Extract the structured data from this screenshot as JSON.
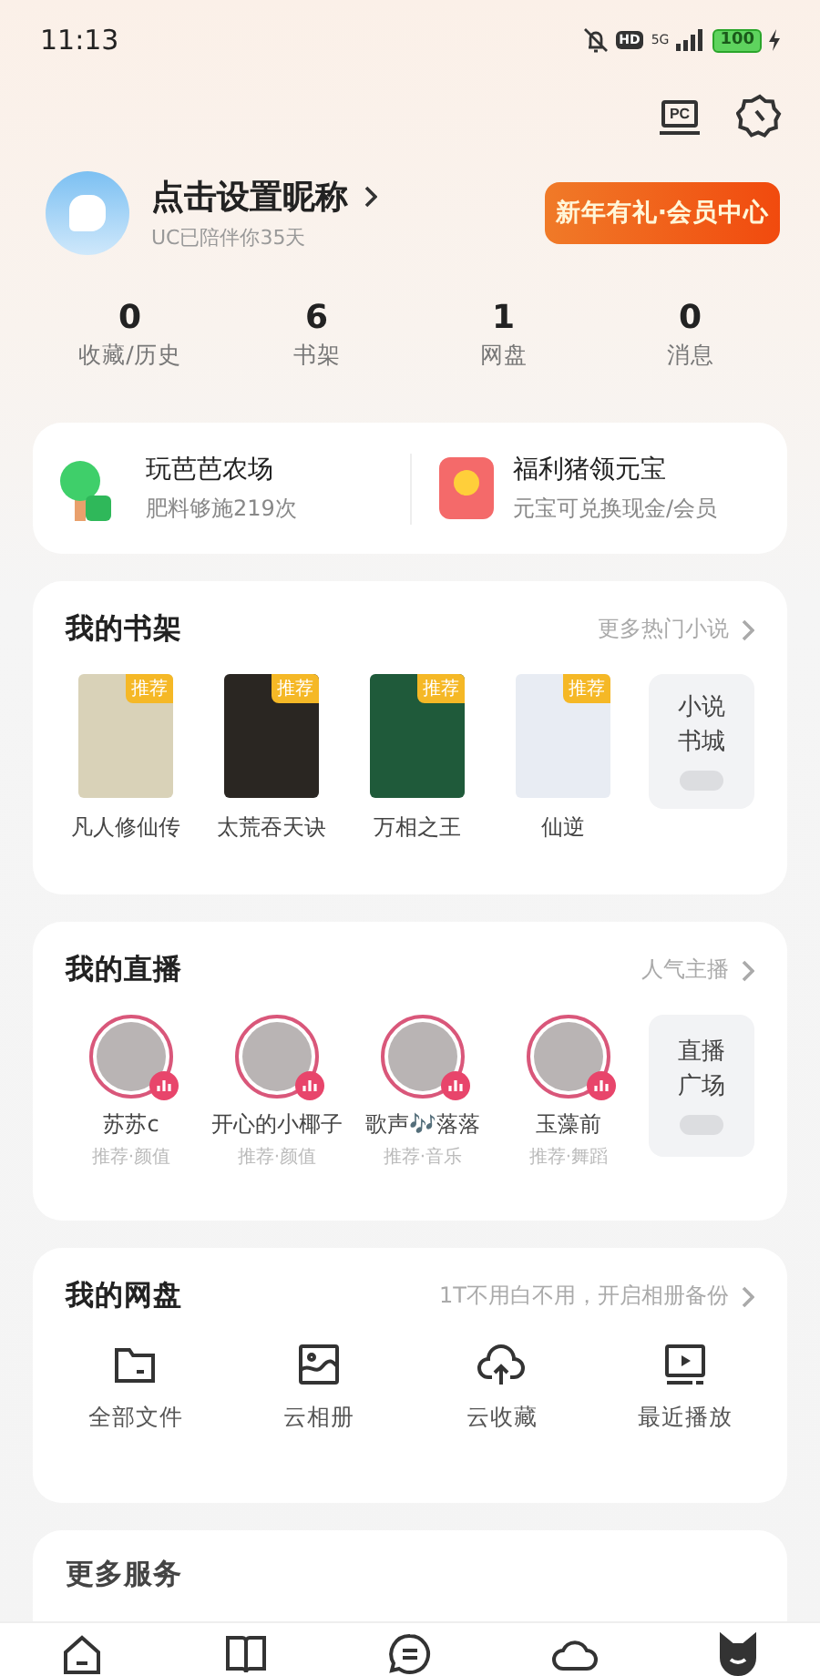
{
  "status_bar": {
    "time": "11:13",
    "hd": "HD",
    "network": "5G",
    "battery": "100"
  },
  "top_actions": {
    "pc_label": "PC"
  },
  "profile": {
    "name": "点击设置昵称",
    "subtitle": "UC已陪伴你35天",
    "vip_button": "新年有礼·会员中心"
  },
  "stats": [
    {
      "value": "0",
      "label": "收藏/历史"
    },
    {
      "value": "6",
      "label": "书架"
    },
    {
      "value": "1",
      "label": "网盘"
    },
    {
      "value": "0",
      "label": "消息"
    }
  ],
  "promos": [
    {
      "kind": "tree",
      "title": "玩芭芭农场",
      "subtitle": "肥料够施219次"
    },
    {
      "kind": "redpacket",
      "title": "福利猪领元宝",
      "subtitle": "元宝可兑换现金/会员"
    }
  ],
  "bookshelf": {
    "title": "我的书架",
    "more": "更多热门小说",
    "books": [
      {
        "title": "凡人修仙传",
        "badge": "推荐",
        "color": "#d9d2b8"
      },
      {
        "title": "太荒吞天诀",
        "badge": "推荐",
        "color": "#2a2622"
      },
      {
        "title": "万相之王",
        "badge": "推荐",
        "color": "#1f5a3a"
      },
      {
        "title": "仙逆",
        "badge": "推荐",
        "color": "#e8ecf3"
      }
    ],
    "store": "小说书城"
  },
  "live": {
    "title": "我的直播",
    "more": "人气主播",
    "streamers": [
      {
        "name": "苏苏c",
        "tags": "推荐·颜值"
      },
      {
        "name": "开心的小椰子",
        "tags": "推荐·颜值"
      },
      {
        "name": "歌声🎶落落",
        "tags": "推荐·音乐"
      },
      {
        "name": "玉藻前",
        "tags": "推荐·舞蹈"
      }
    ],
    "plaza": "直播广场"
  },
  "disk": {
    "title": "我的网盘",
    "more": "1T不用白不用，开启相册备份",
    "items": [
      {
        "kind": "folder",
        "label": "全部文件"
      },
      {
        "kind": "image",
        "label": "云相册"
      },
      {
        "kind": "cloud",
        "label": "云收藏"
      },
      {
        "kind": "video",
        "label": "最近播放"
      }
    ]
  },
  "services": {
    "title": "更多服务"
  },
  "bottom_nav": [
    {
      "kind": "home",
      "selected": false
    },
    {
      "kind": "book",
      "selected": false
    },
    {
      "kind": "chat",
      "selected": false
    },
    {
      "kind": "cloud",
      "selected": false
    },
    {
      "kind": "cat",
      "selected": true
    }
  ]
}
